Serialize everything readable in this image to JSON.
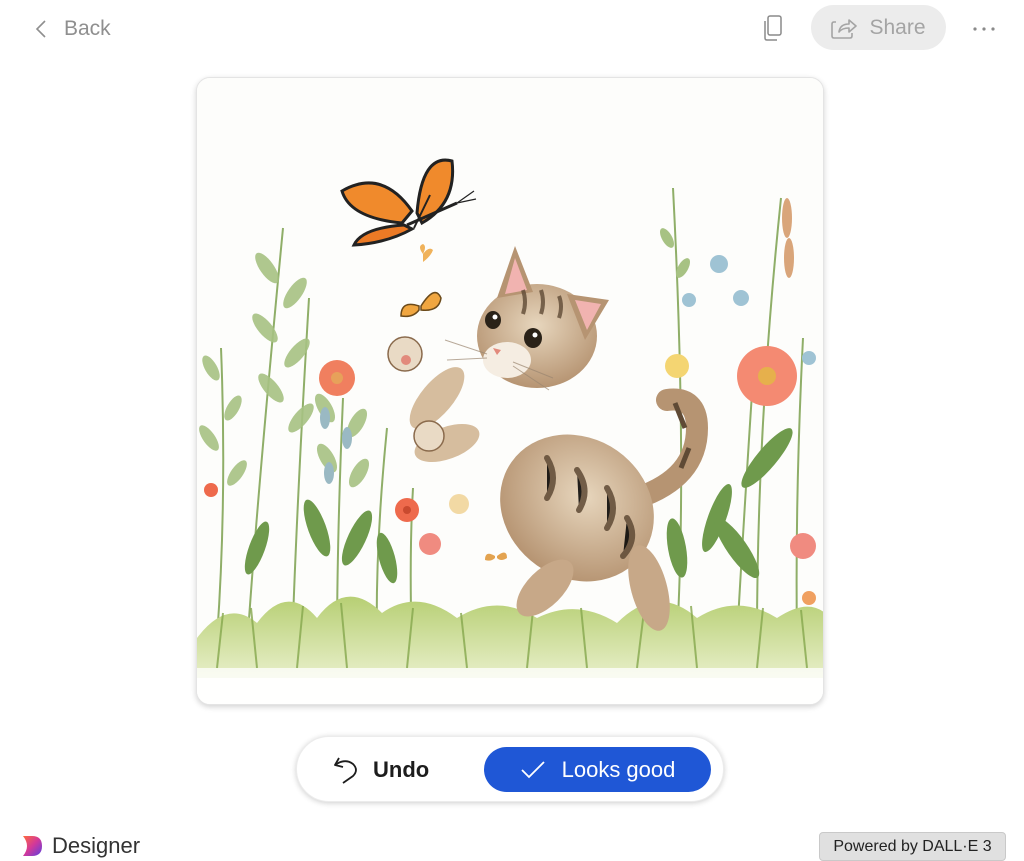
{
  "topbar": {
    "back_label": "Back",
    "share_label": "Share",
    "icons": {
      "back": "chevron-left-icon",
      "copy": "copy-icon",
      "share": "share-icon",
      "more": "more-icon"
    }
  },
  "image": {
    "subject": "kitten-butterfly-meadow-illustration"
  },
  "actions": {
    "undo_label": "Undo",
    "looks_good_label": "Looks good",
    "icons": {
      "undo": "undo-icon",
      "looks_good": "checkmark-icon"
    }
  },
  "footer": {
    "brand_name": "Designer",
    "powered_by": "Powered by DALL·E 3"
  },
  "colors": {
    "accent": "#1f57d6",
    "share_bg": "#ececec",
    "muted_text": "#8f8f8f",
    "badge_bg": "#e0e0e0"
  }
}
